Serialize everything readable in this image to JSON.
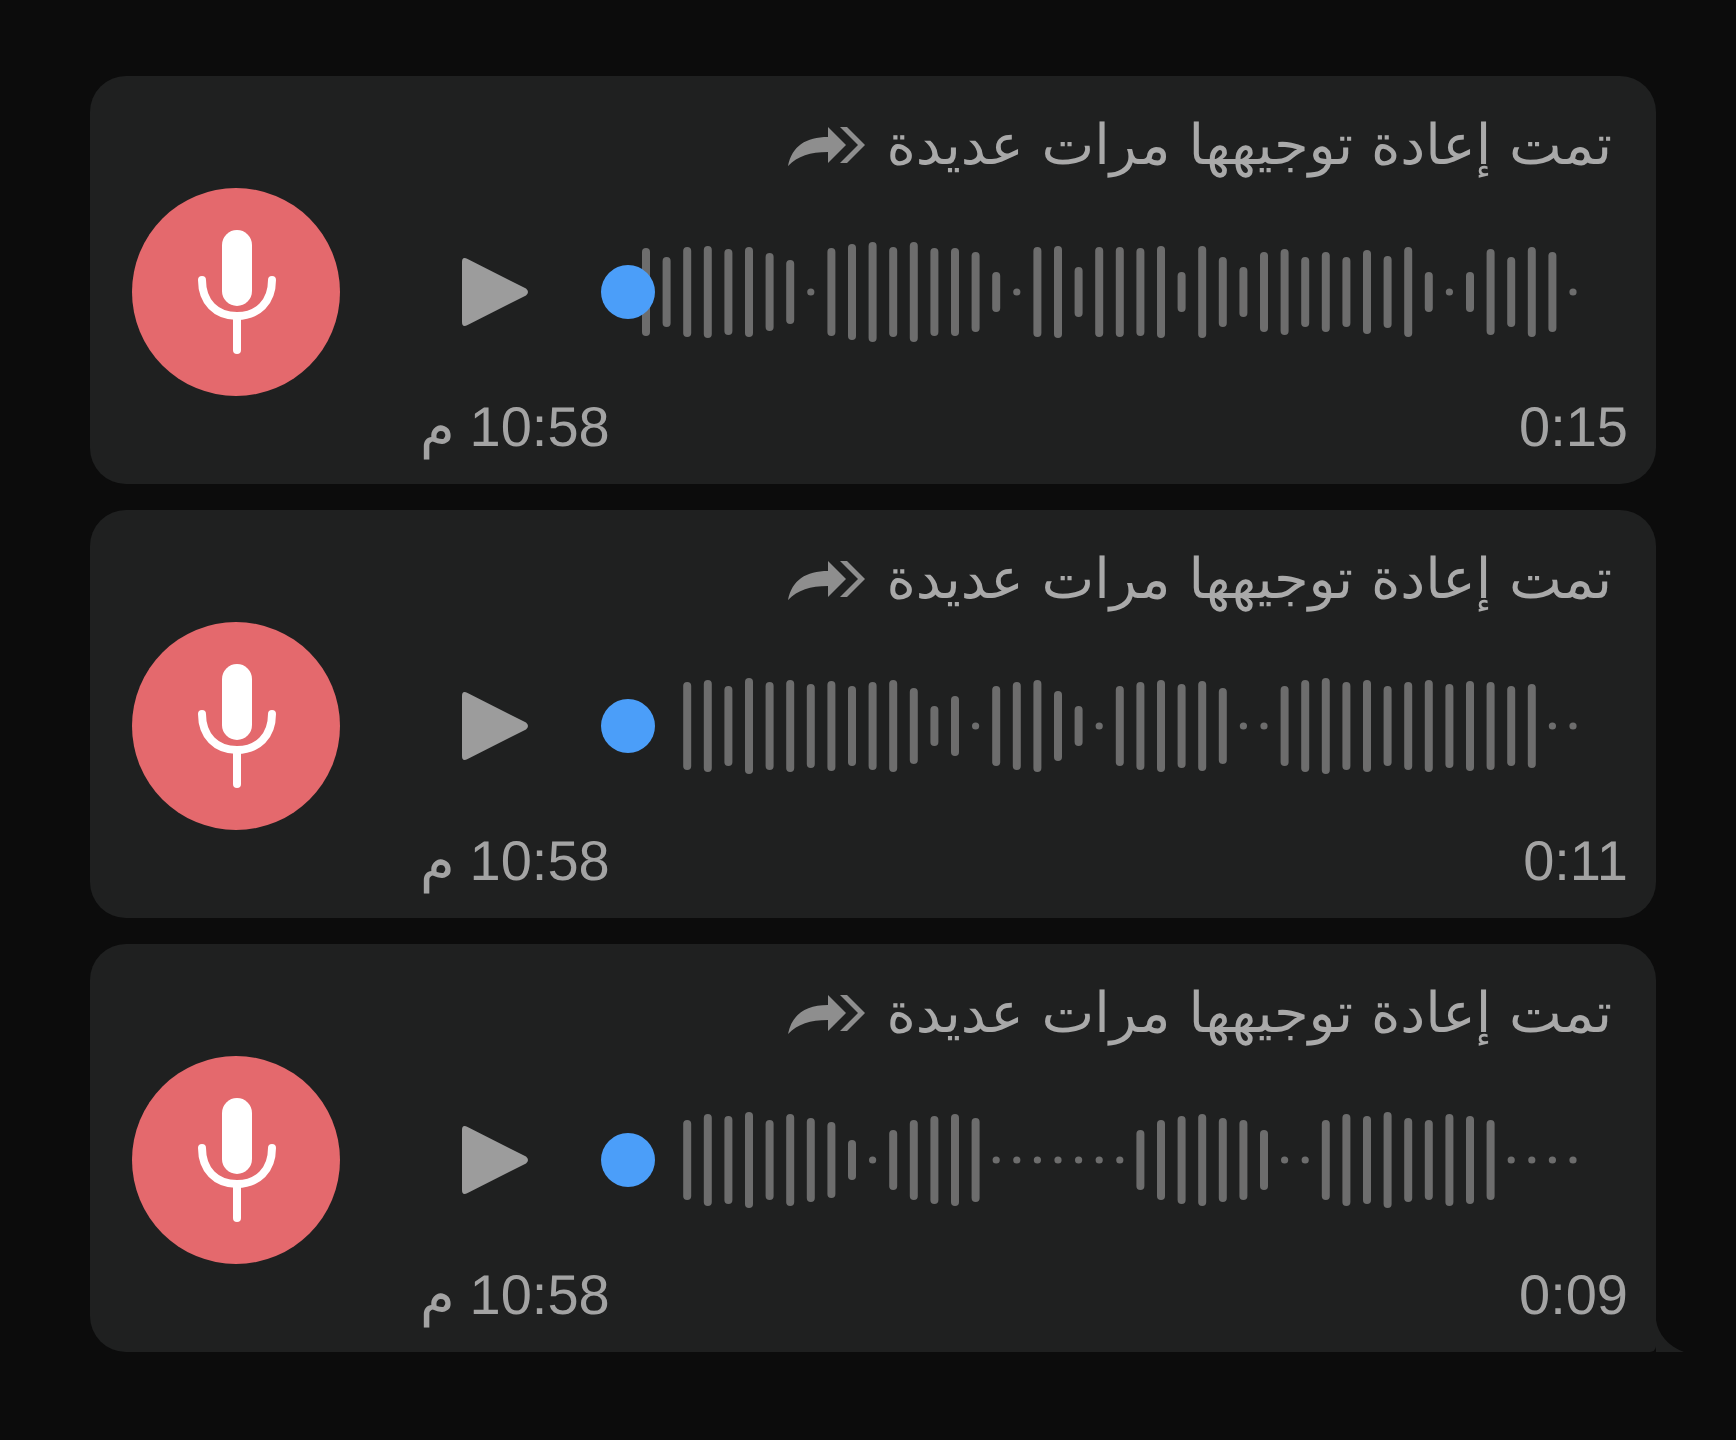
{
  "messages": [
    {
      "forwarded": "تمت إعادة توجيهها مرات عديدة",
      "level": 0,
      "time": "10:58 م",
      "duration": "0:15",
      "tail": false
    },
    {
      "forwarded": "تمت إعادة توجيهها مرات عديدة",
      "level": 0,
      "time": "10:58 م",
      "duration": "0:11",
      "tail": false
    },
    {
      "forwarded": "تمت إعادة توجيهها مرات عديدة",
      "level": 0,
      "time": "10:58 م",
      "duration": "0:09",
      "tail": true
    }
  ]
}
